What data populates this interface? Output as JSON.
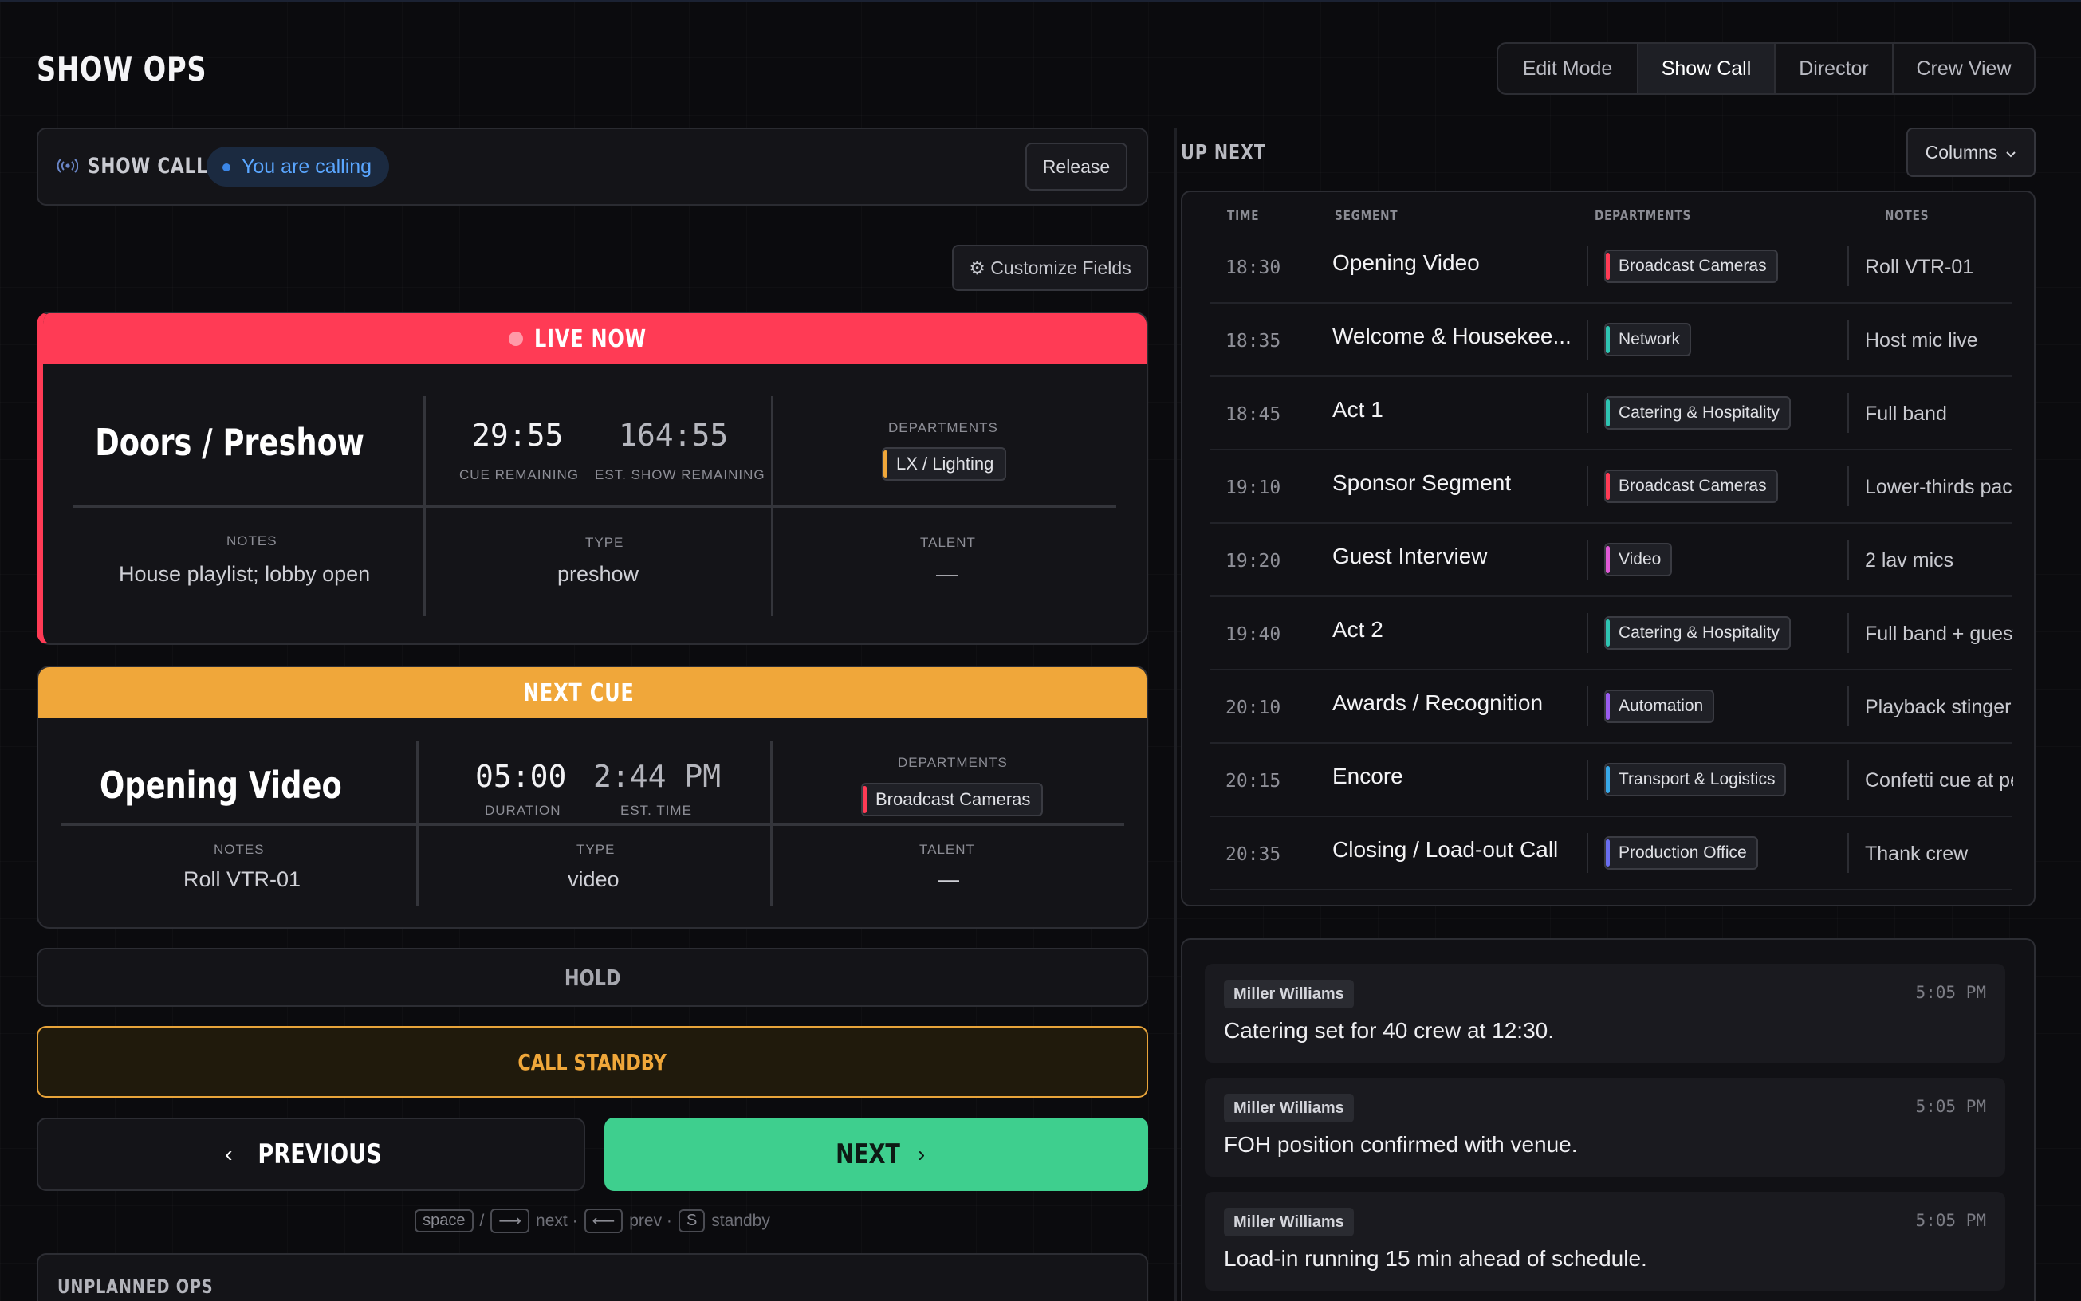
{
  "header": {
    "title": "SHOW OPS",
    "views": [
      "Edit Mode",
      "Show Call",
      "Director",
      "Crew View"
    ],
    "active_view": "Show Call"
  },
  "caller": {
    "label": "SHOW CALLER",
    "status": "You are calling",
    "release_label": "Release"
  },
  "customize_label": "⚙ Customize Fields",
  "live": {
    "header": "LIVE NOW",
    "title": "Doors / Preshow",
    "cue_remaining": "29:55",
    "cue_remaining_label": "CUE REMAINING",
    "show_remaining": "164:55",
    "show_remaining_label": "EST. SHOW REMAINING",
    "departments_label": "DEPARTMENTS",
    "department": "LX / Lighting",
    "department_color": "#f0a73a",
    "notes_label": "NOTES",
    "notes": "House playlist; lobby open",
    "type_label": "TYPE",
    "type": "preshow",
    "talent_label": "TALENT",
    "talent": "—"
  },
  "next": {
    "header": "NEXT CUE",
    "title": "Opening Video",
    "duration": "05:00",
    "duration_label": "DURATION",
    "est_time": "2:44 PM",
    "est_time_label": "EST. TIME",
    "departments_label": "DEPARTMENTS",
    "department": "Broadcast Cameras",
    "department_color": "#ff3b55",
    "notes_label": "NOTES",
    "notes": "Roll VTR-01",
    "type_label": "TYPE",
    "type": "video",
    "talent_label": "TALENT",
    "talent": "—"
  },
  "actions": {
    "hold": "HOLD",
    "standby": "CALL STANDBY",
    "previous": "PREVIOUS",
    "next": "NEXT",
    "hint_space": "space",
    "hint_slash": "/",
    "hint_next_key": "⟶",
    "hint_next": "next ·",
    "hint_prev_key": "⟵",
    "hint_prev": "prev ·",
    "hint_standby_key": "S",
    "hint_standby": "standby"
  },
  "unplanned": {
    "label": "UNPLANNED OPS"
  },
  "upnext": {
    "label": "UP NEXT",
    "columns_label": "Columns",
    "headers": {
      "time": "TIME",
      "segment": "SEGMENT",
      "departments": "DEPARTMENTS",
      "notes": "NOTES"
    },
    "rows": [
      {
        "time": "18:30",
        "segment": "Opening Video",
        "department": "Broadcast Cameras",
        "color": "#ff3b55",
        "notes": "Roll VTR-01"
      },
      {
        "time": "18:35",
        "segment": "Welcome & Housekee...",
        "department": "Network",
        "color": "#2fc4b2",
        "notes": "Host mic live"
      },
      {
        "time": "18:45",
        "segment": "Act 1",
        "department": "Catering & Hospitality",
        "color": "#2fc4b2",
        "notes": "Full band"
      },
      {
        "time": "19:10",
        "segment": "Sponsor Segment",
        "department": "Broadcast Cameras",
        "color": "#ff3b55",
        "notes": "Lower-thirds pack"
      },
      {
        "time": "19:20",
        "segment": "Guest Interview",
        "department": "Video",
        "color": "#e05ad6",
        "notes": "2 lav mics"
      },
      {
        "time": "19:40",
        "segment": "Act 2",
        "department": "Catering & Hospitality",
        "color": "#2fc4b2",
        "notes": "Full band + guest"
      },
      {
        "time": "20:10",
        "segment": "Awards / Recognition",
        "department": "Automation",
        "color": "#9a5cf0",
        "notes": "Playback stinger"
      },
      {
        "time": "20:15",
        "segment": "Encore",
        "department": "Transport & Logistics",
        "color": "#38a8e8",
        "notes": "Confetti cue at pe"
      },
      {
        "time": "20:35",
        "segment": "Closing / Load-out Call",
        "department": "Production Office",
        "color": "#6a6ef0",
        "notes": "Thank crew"
      }
    ]
  },
  "messages": [
    {
      "author": "Miller Williams",
      "time": "5:05 PM",
      "text": "Catering set for 40 crew at 12:30."
    },
    {
      "author": "Miller Williams",
      "time": "5:05 PM",
      "text": "FOH position confirmed with venue."
    },
    {
      "author": "Miller Williams",
      "time": "5:05 PM",
      "text": "Load-in running 15 min ahead of schedule."
    }
  ]
}
